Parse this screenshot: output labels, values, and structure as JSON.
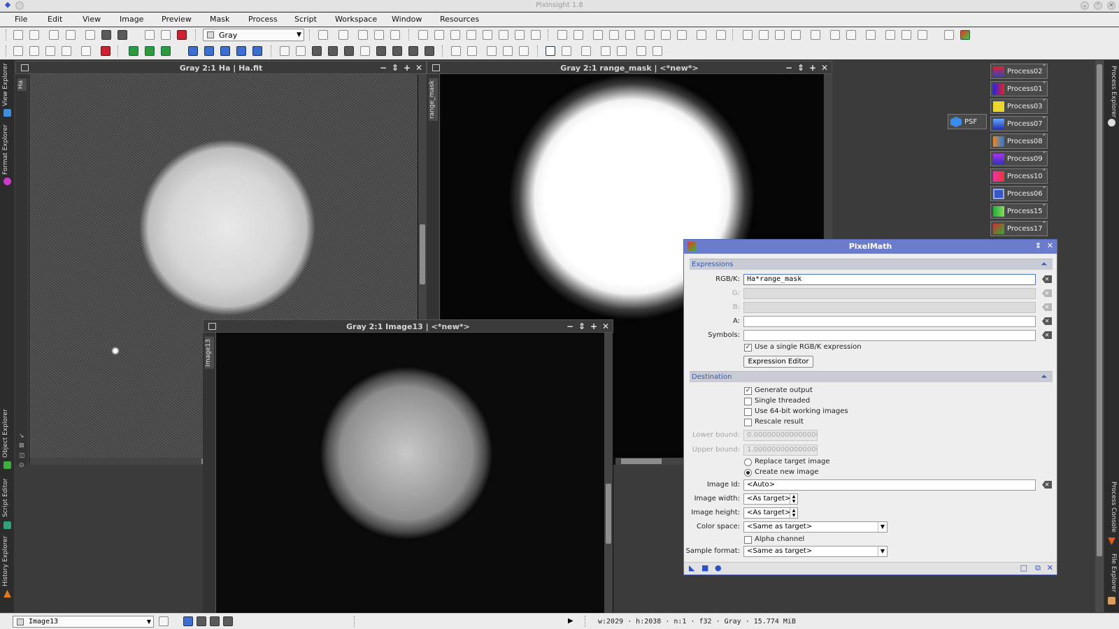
{
  "app": {
    "title": "PixInsight 1.8"
  },
  "menu": [
    "File",
    "Edit",
    "View",
    "Image",
    "Preview",
    "Mask",
    "Process",
    "Script",
    "Workspace",
    "Window",
    "Resources"
  ],
  "toolbar": {
    "colorspace_selected": "Gray"
  },
  "left_dock": {
    "tabs": [
      "View Explorer",
      "Format Explorer",
      "Object Explorer",
      "Script Editor",
      "History Explorer"
    ]
  },
  "right_dock": {
    "tabs": [
      "Process Explorer",
      "Process Console",
      "File Explorer"
    ]
  },
  "windows": {
    "ha": {
      "title": "Gray 2:1 Ha | Ha.fit",
      "side_label": "Ha"
    },
    "mask": {
      "title": "Gray 2:1 range_mask | <*new*>",
      "side_label": "range_mask"
    },
    "image13": {
      "title": "Gray 2:1 Image13 | <*new*>",
      "side_label": "Image13"
    }
  },
  "process_icons": [
    "Process02",
    "Process01",
    "Process03",
    "Process07",
    "Process08",
    "Process09",
    "Process10",
    "Process06",
    "Process15",
    "Process17"
  ],
  "psf_icon": "PSF",
  "pixelmath": {
    "title": "PixelMath",
    "expressions": {
      "header": "Expressions",
      "rgbk_label": "RGB/K:",
      "rgbk_value": "Ha*range_mask",
      "g_label": "G:",
      "b_label": "B:",
      "a_label": "A:",
      "symbols_label": "Symbols:",
      "single_expr_label": "Use a single RGB/K expression",
      "expr_editor_button": "Expression Editor"
    },
    "destination": {
      "header": "Destination",
      "generate_output": "Generate output",
      "single_threaded": "Single threaded",
      "use64": "Use 64-bit working images",
      "rescale": "Rescale result",
      "lower_label": "Lower bound:",
      "lower_value": "0.000000000000000",
      "upper_label": "Upper bound:",
      "upper_value": "1.000000000000000",
      "replace_target": "Replace target image",
      "create_new": "Create new image",
      "image_id_label": "Image Id:",
      "image_id_value": "<Auto>",
      "width_label": "Image width:",
      "width_value": "<As target>",
      "height_label": "Image height:",
      "height_value": "<As target>",
      "colorspace_label": "Color space:",
      "colorspace_value": "<Same as target>",
      "alpha_label": "Alpha channel",
      "sample_label": "Sample format:",
      "sample_value": "<Same as target>"
    }
  },
  "statusbar": {
    "view_selected": "Image13",
    "info": "w:2029 · h:2038 · n:1 · f32 · Gray · 15.774 MiB"
  }
}
